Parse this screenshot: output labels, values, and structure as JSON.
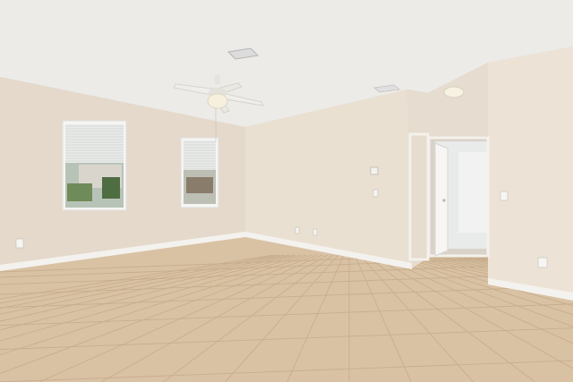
{
  "scene": {
    "description_label": "",
    "colors": {
      "ceiling": "#ecebe8",
      "wall_left": "#e4d9cb",
      "wall_back": "#eae0d2",
      "wall_right": "#ece3d6",
      "wall_hall": "#e6dccf",
      "floor": "#d9c2a4",
      "floor_grout": "#c7ad8c",
      "baseboard": "#f4f2ee",
      "window_frame": "#f5f5f3",
      "blind": "#e9ebea",
      "fan": "#f0eeea",
      "trim": "#f1eee8"
    },
    "icons": [
      "ceiling-fan-icon",
      "air-vent-icon",
      "ceiling-light-icon",
      "thermostat-icon",
      "light-switch-icon",
      "outlet-icon"
    ]
  }
}
